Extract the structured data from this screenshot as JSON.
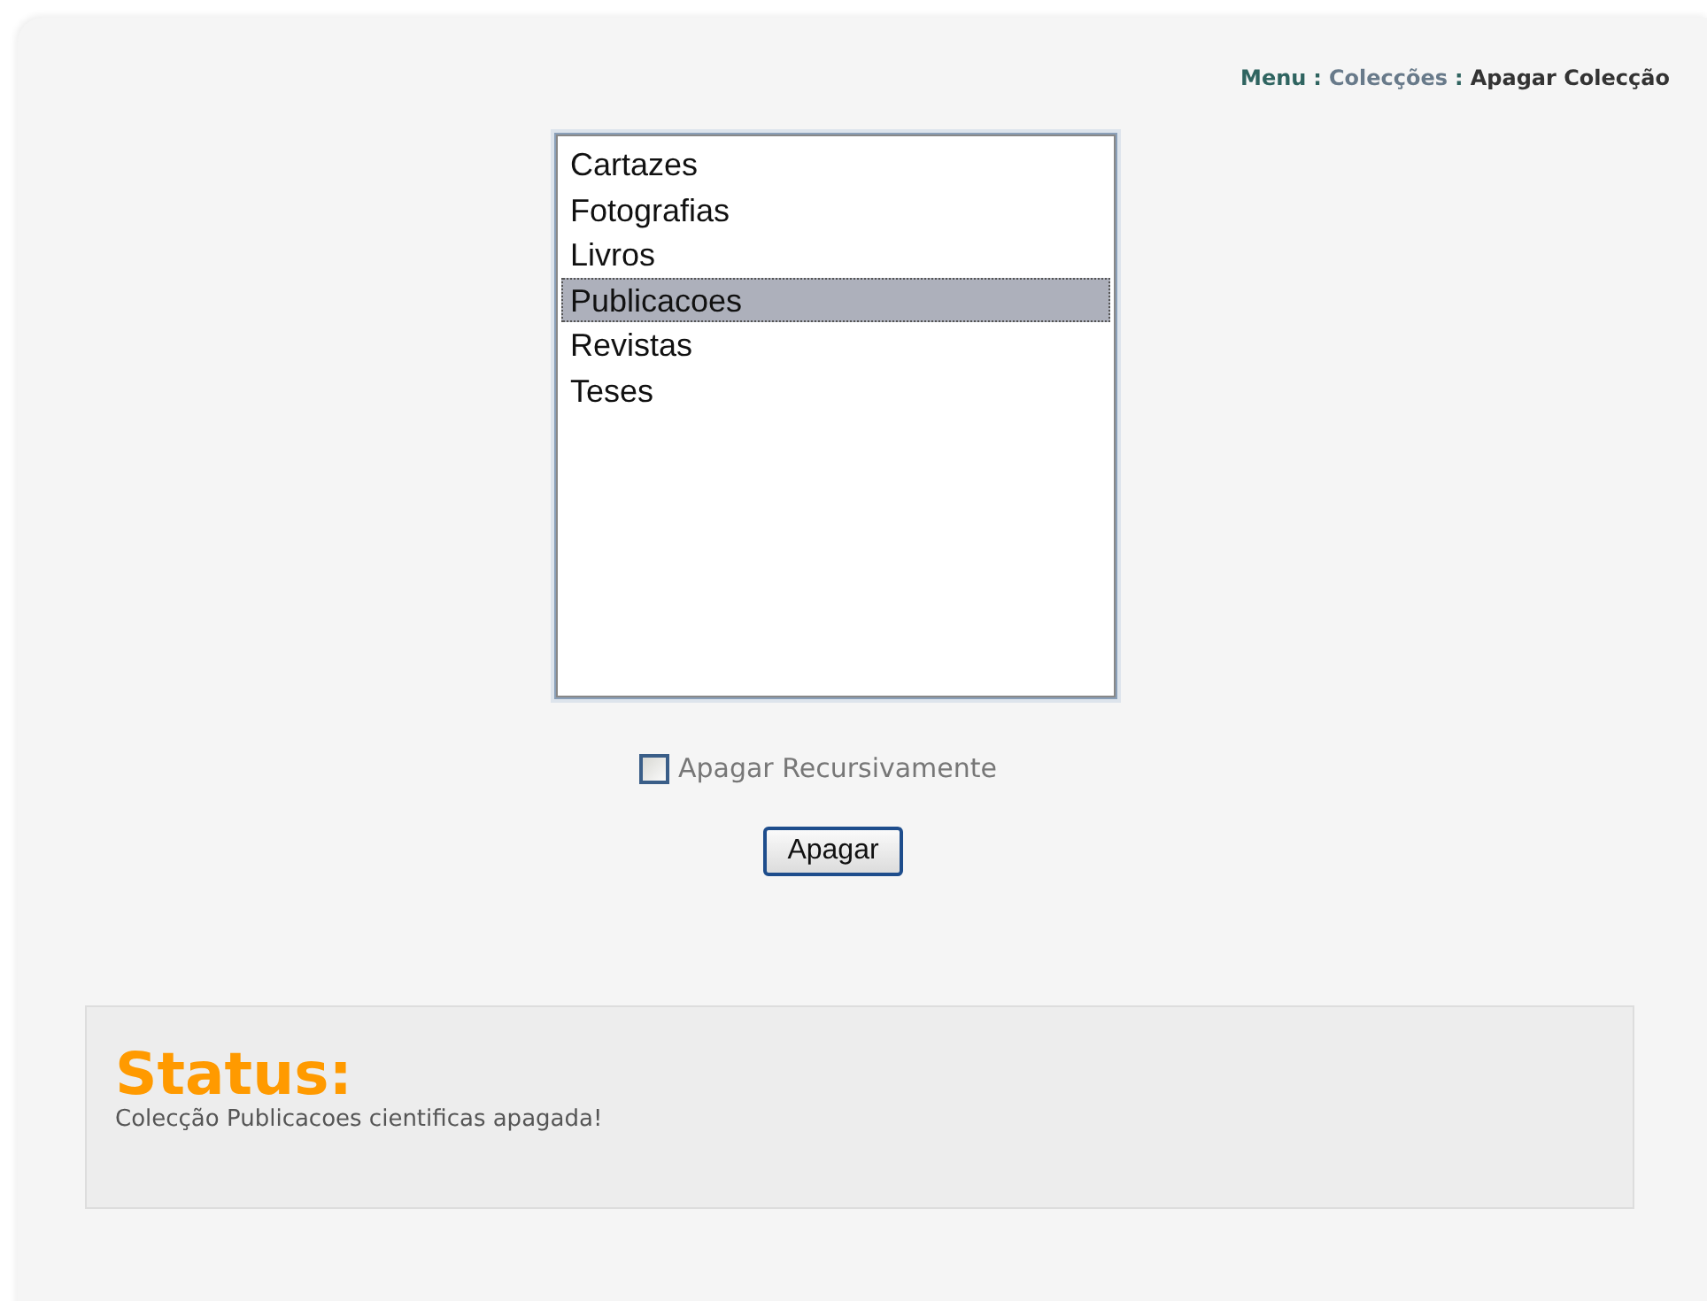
{
  "breadcrumb": {
    "separator": ":",
    "items": [
      {
        "label": "Menu",
        "kind": "home"
      },
      {
        "label": "Colecções",
        "kind": "link"
      },
      {
        "label": "Apagar Colecção",
        "kind": "current"
      }
    ]
  },
  "listbox": {
    "options": [
      {
        "label": "Cartazes",
        "selected": false
      },
      {
        "label": "Fotografias",
        "selected": false
      },
      {
        "label": "Livros",
        "selected": false
      },
      {
        "label": "Publicacoes",
        "selected": true
      },
      {
        "label": "Revistas",
        "selected": false
      },
      {
        "label": "Teses",
        "selected": false
      }
    ]
  },
  "recursive_checkbox": {
    "label": "Apagar Recursivamente",
    "checked": false
  },
  "submit_button": {
    "label": "Apagar"
  },
  "status": {
    "title": "Status:",
    "message": "Colecção Publicacoes cientificas apagada!"
  }
}
